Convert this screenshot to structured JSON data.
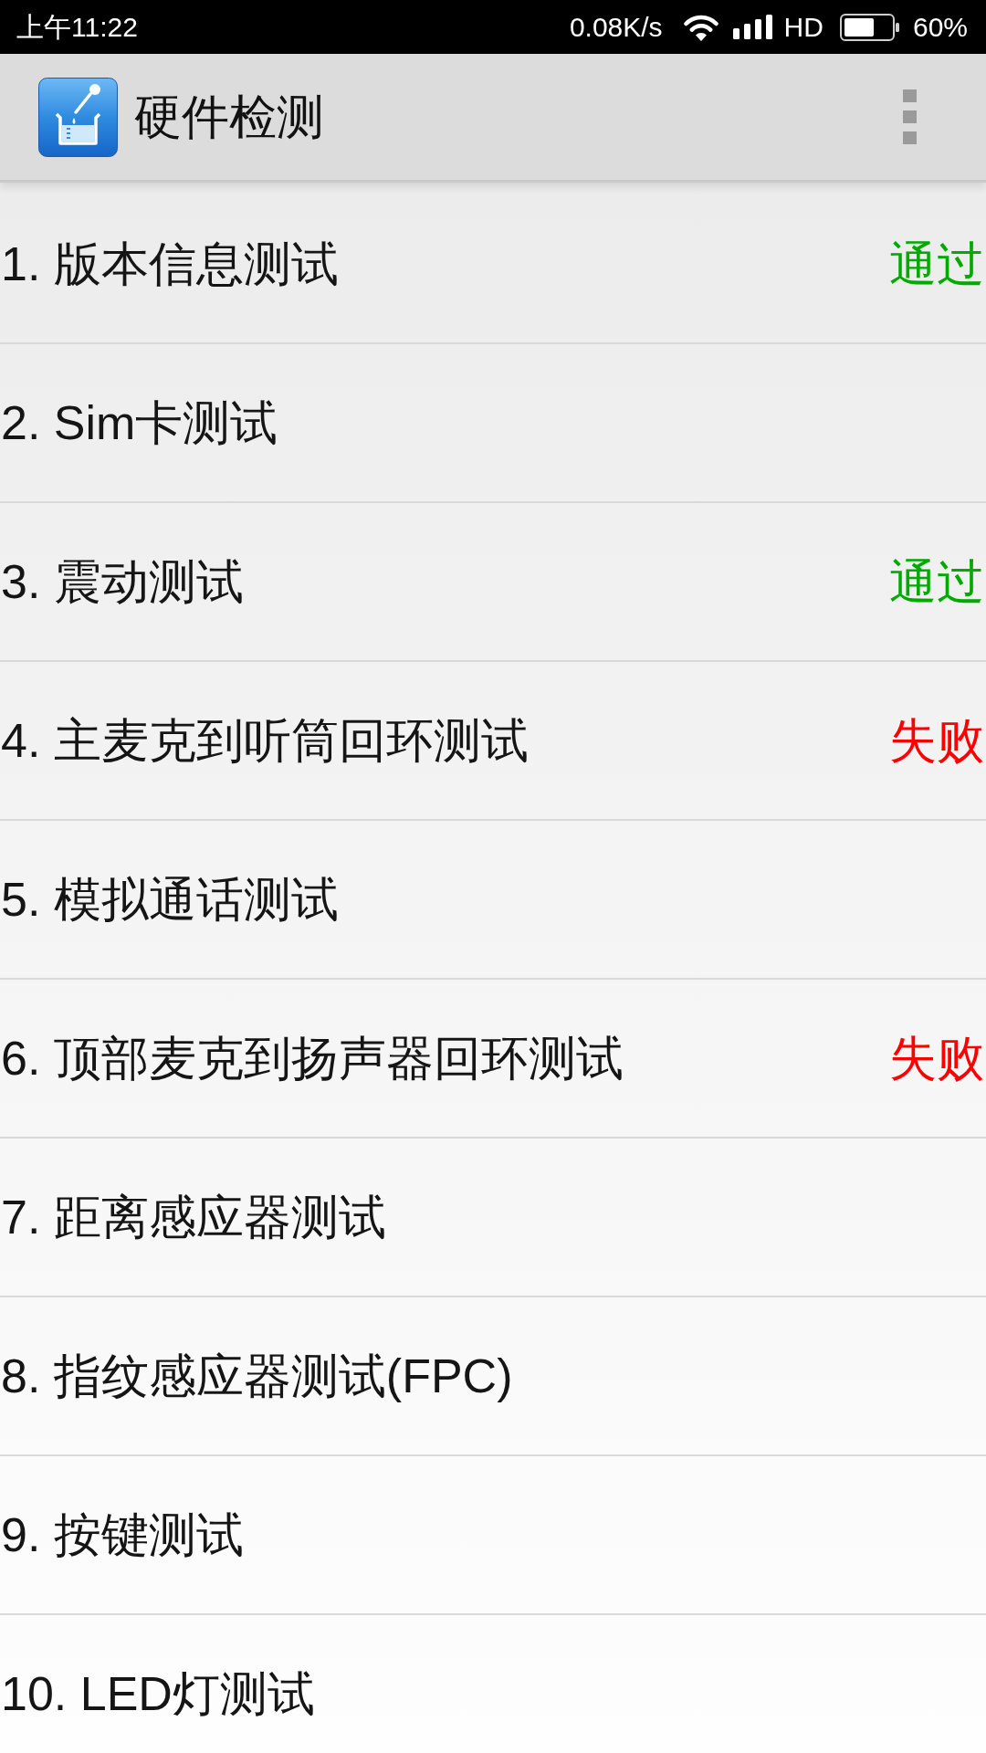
{
  "status_bar": {
    "time": "上午11:22",
    "network_speed": "0.08K/s",
    "network_type": "HD",
    "battery": "60%"
  },
  "app_bar": {
    "title": "硬件检测"
  },
  "tests": [
    {
      "label": "1. 版本信息测试",
      "result": {
        "text": "通过",
        "color": "#00aa00"
      }
    },
    {
      "label": "2. Sim卡测试"
    },
    {
      "label": "3. 震动测试",
      "result": {
        "text": "通过",
        "color": "#00aa00"
      }
    },
    {
      "label": "4. 主麦克到听筒回环测试",
      "result": {
        "text": "失败",
        "color": "#ff0000"
      }
    },
    {
      "label": "5. 模拟通话测试"
    },
    {
      "label": "6. 顶部麦克到扬声器回环测试",
      "result": {
        "text": "失败",
        "color": "#ff0000"
      }
    },
    {
      "label": "7. 距离感应器测试"
    },
    {
      "label": "8. 指纹感应器测试(FPC)"
    },
    {
      "label": "9. 按键测试"
    },
    {
      "label": "10. LED灯测试"
    }
  ]
}
